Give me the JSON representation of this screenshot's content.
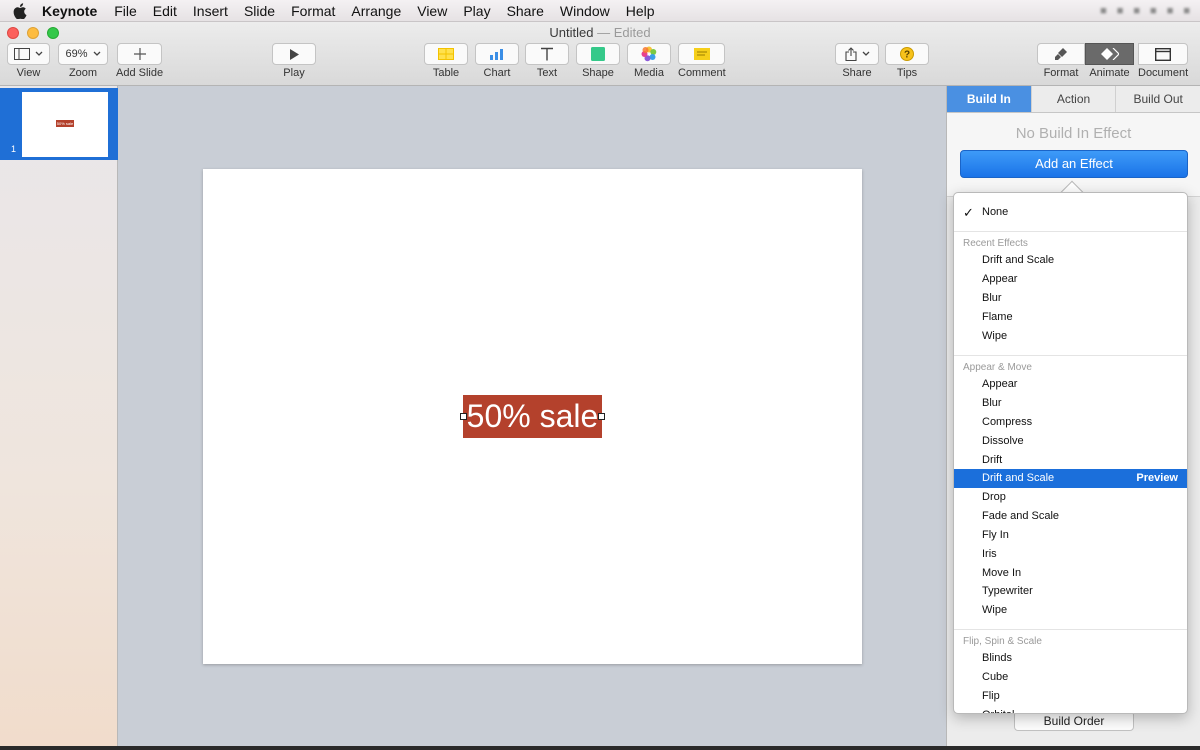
{
  "menubar": {
    "app_name": "Keynote",
    "items": [
      "File",
      "Edit",
      "Insert",
      "Slide",
      "Format",
      "Arrange",
      "View",
      "Play",
      "Share",
      "Window",
      "Help"
    ]
  },
  "window": {
    "title": "Untitled",
    "separator": "—",
    "status": "Edited"
  },
  "toolbar": {
    "view": {
      "label": "View",
      "icon": "sidebar-layout-icon"
    },
    "zoom": {
      "label": "Zoom",
      "value": "69%"
    },
    "add_slide": {
      "label": "Add Slide",
      "icon": "plus-icon"
    },
    "play": {
      "label": "Play",
      "icon": "play-icon"
    },
    "table": {
      "label": "Table",
      "icon": "table-icon"
    },
    "chart": {
      "label": "Chart",
      "icon": "chart-icon"
    },
    "text": {
      "label": "Text",
      "icon": "text-icon"
    },
    "shape": {
      "label": "Shape",
      "icon": "shape-icon"
    },
    "media": {
      "label": "Media",
      "icon": "photos-icon"
    },
    "comment": {
      "label": "Comment",
      "icon": "comment-icon"
    },
    "share": {
      "label": "Share",
      "icon": "share-icon"
    },
    "tips": {
      "label": "Tips",
      "icon": "question-icon"
    },
    "format": {
      "label": "Format",
      "icon": "paintbrush-icon"
    },
    "animate": {
      "label": "Animate",
      "icon": "diamond-icon"
    },
    "document": {
      "label": "Document",
      "icon": "document-icon"
    }
  },
  "navigator": {
    "slides": [
      {
        "number": "1",
        "thumb_text": "50% sale"
      }
    ]
  },
  "slide": {
    "text": "50% sale",
    "text_bg": "#b4412c"
  },
  "inspector": {
    "tabs": [
      "Build In",
      "Action",
      "Build Out"
    ],
    "active_tab": "Build In",
    "empty_message": "No Build In Effect",
    "add_button": "Add an Effect",
    "build_order_button": "Build Order"
  },
  "effect_menu": {
    "none_label": "None",
    "check": "✓",
    "recent_header": "Recent Effects",
    "recent": [
      "Drift and Scale",
      "Appear",
      "Blur",
      "Flame",
      "Wipe"
    ],
    "appear_move_header": "Appear & Move",
    "appear_move": [
      "Appear",
      "Blur",
      "Compress",
      "Dissolve",
      "Drift",
      "Drift and Scale",
      "Drop",
      "Fade and Scale",
      "Fly In",
      "Iris",
      "Move In",
      "Typewriter",
      "Wipe"
    ],
    "flip_header": "Flip, Spin & Scale",
    "flip": [
      "Blinds",
      "Cube",
      "Flip",
      "Orbital"
    ],
    "highlighted": "Drift and Scale",
    "preview_label": "Preview",
    "accent": "#1b6fdb"
  }
}
